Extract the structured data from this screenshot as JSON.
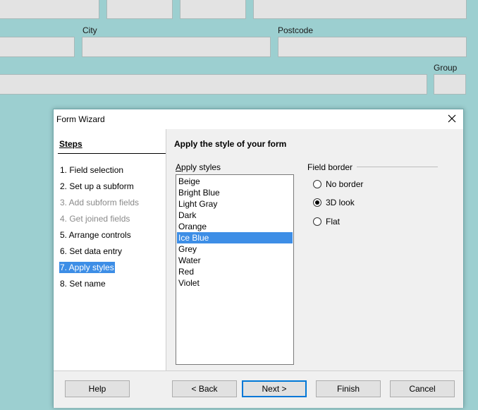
{
  "background": {
    "labels": {
      "city": "City",
      "postcode": "Postcode",
      "group": "Group"
    }
  },
  "dialog": {
    "title": "Form Wizard",
    "close_icon": "close-icon",
    "steps_heading": "Steps",
    "steps": [
      {
        "label": "1. Field selection",
        "state": "enabled"
      },
      {
        "label": "2. Set up a subform",
        "state": "enabled"
      },
      {
        "label": "3. Add subform fields",
        "state": "disabled"
      },
      {
        "label": "4. Get joined fields",
        "state": "disabled"
      },
      {
        "label": "5. Arrange controls",
        "state": "enabled"
      },
      {
        "label": "6. Set data entry",
        "state": "enabled"
      },
      {
        "label": "7. Apply styles",
        "state": "active"
      },
      {
        "label": "8. Set name",
        "state": "enabled"
      }
    ],
    "main_heading": "Apply the style of your form",
    "styles_label": "Apply styles",
    "styles": [
      "Beige",
      "Bright Blue",
      "Light Gray",
      "Dark",
      "Orange",
      "Ice Blue",
      "Grey",
      "Water",
      "Red",
      "Violet"
    ],
    "selected_style": "Ice Blue",
    "field_border_label": "Field border",
    "field_border_options": [
      "No border",
      "3D look",
      "Flat"
    ],
    "field_border_selected": "3D look",
    "buttons": {
      "help": "Help",
      "back": "< Back",
      "next": "Next >",
      "finish": "Finish",
      "cancel": "Cancel"
    },
    "colors": {
      "selection": "#3d8ee6",
      "background": "#9ccfd0"
    }
  }
}
